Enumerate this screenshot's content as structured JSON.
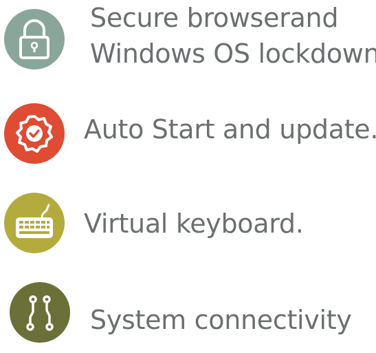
{
  "features": [
    {
      "icon": "padlock-icon",
      "color": "#8aa69a",
      "line1": "Secure browserand",
      "line2": "Windows OS lockdown."
    },
    {
      "icon": "check-badge-icon",
      "color": "#df4b33",
      "line1": "Auto Start and update."
    },
    {
      "icon": "keyboard-icon",
      "color": "#b3ab3d",
      "line1": "Virtual keyboard."
    },
    {
      "icon": "connectivity-icon",
      "color": "#6b6f38",
      "line1": "System connectivity"
    }
  ]
}
